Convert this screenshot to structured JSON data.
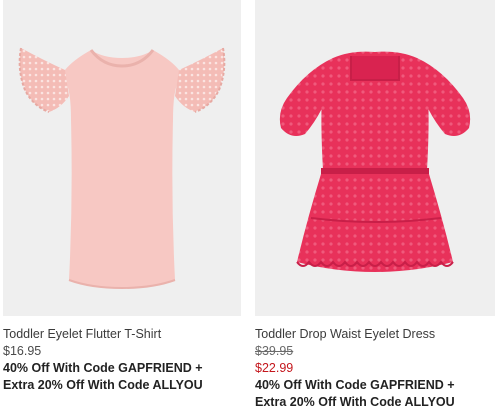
{
  "products": [
    {
      "name": "Toddler Eyelet Flutter T-Shirt",
      "price": "$16.95",
      "promo_line1": "40% Off With Code GAPFRIEND +",
      "promo_line2": "Extra 20% Off With Code ALLYOU",
      "image_icon": "pink-flutter-tshirt-image",
      "garment_color": "#f7c8c3",
      "background_color": "#efefef"
    },
    {
      "name": "Toddler Drop Waist Eyelet Dress",
      "original_price": "$39.95",
      "sale_price": "$22.99",
      "promo_line1": "40% Off With Code GAPFRIEND +",
      "promo_line2": "Extra 20% Off With Code ALLYOU",
      "image_icon": "pink-eyelet-dress-image",
      "garment_color": "#e8315a",
      "background_color": "#efefef"
    }
  ],
  "colors": {
    "sale_price": "#c4161c",
    "text": "#333333"
  }
}
